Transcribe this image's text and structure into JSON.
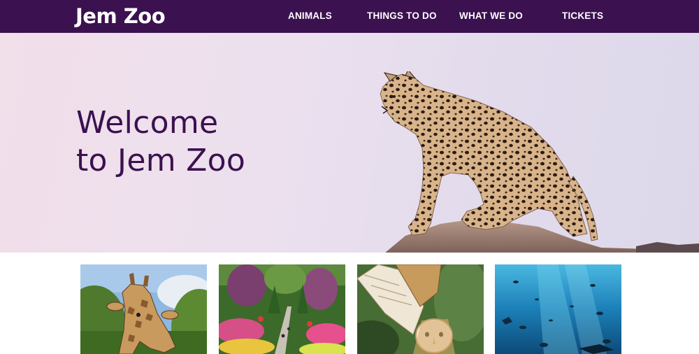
{
  "header": {
    "logo": "Jem Zoo",
    "nav": [
      {
        "label": "ANIMALS"
      },
      {
        "label": "THINGS TO DO"
      },
      {
        "label": "WHAT WE DO"
      },
      {
        "label": "TICKETS"
      }
    ]
  },
  "hero": {
    "title_line1": "Welcome",
    "title_line2": "to Jem Zoo",
    "image": "leopard-on-rock"
  },
  "cards": [
    {
      "image": "giraffe"
    },
    {
      "image": "garden"
    },
    {
      "image": "barn-owl"
    },
    {
      "image": "aquarium"
    }
  ],
  "colors": {
    "brand": "#3b1150",
    "hero_bg": "#ece0ee"
  }
}
